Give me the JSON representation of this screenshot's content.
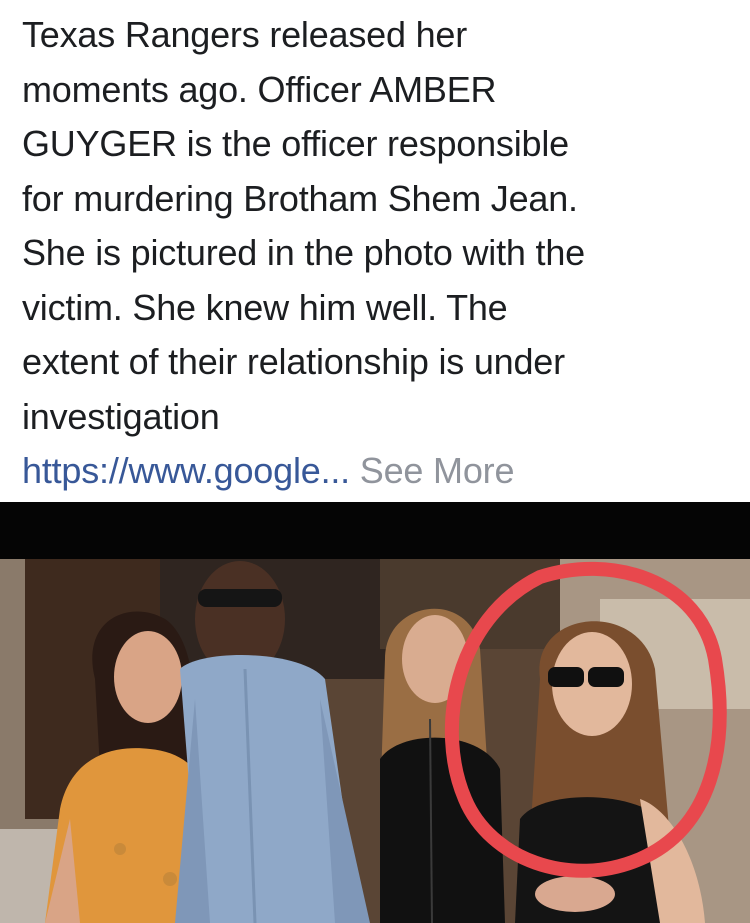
{
  "post": {
    "lines": [
      "Texas Rangers released her",
      "moments ago. Officer AMBER",
      "GUYGER is the officer responsible",
      "for murdering Brotham Shem Jean.",
      "She is pictured in the photo with the",
      "victim. She knew him well. The",
      "extent of their relationship is under",
      "investigation"
    ],
    "link_text": "https://www.google...",
    "see_more_label": "See More"
  },
  "photo": {
    "circle_color": "#e8484d",
    "link_color": "#385898",
    "see_more_color": "#90949c"
  }
}
